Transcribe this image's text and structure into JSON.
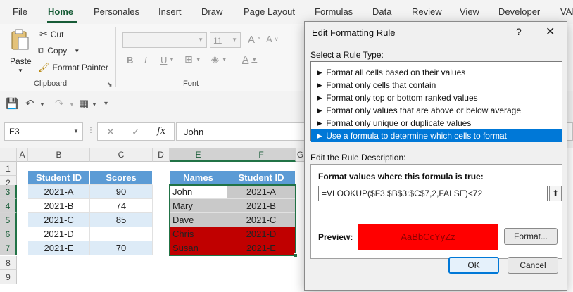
{
  "tabs": [
    "File",
    "Home",
    "Personales",
    "Insert",
    "Draw",
    "Page Layout",
    "Formulas",
    "Data",
    "Review",
    "View",
    "Developer",
    "VAI"
  ],
  "ribbon": {
    "paste_label": "Paste",
    "cut_label": "Cut",
    "copy_label": "Copy",
    "format_painter_label": "Format Painter",
    "clipboard_group": "Clipboard",
    "font_size": "11",
    "font_group": "Font",
    "bold": "B",
    "italic": "I",
    "underline": "U"
  },
  "formula_bar": {
    "name_box": "E3",
    "fx": "fx",
    "value": "John"
  },
  "columns": [
    "A",
    "B",
    "C",
    "D",
    "E",
    "F",
    "G"
  ],
  "rows": [
    "1",
    "2",
    "3",
    "4",
    "5",
    "6",
    "7",
    "8",
    "9"
  ],
  "scores_table": {
    "headers": [
      "Student ID",
      "Scores"
    ],
    "rows": [
      [
        "2021-A",
        "90"
      ],
      [
        "2021-B",
        "74"
      ],
      [
        "2021-C",
        "85"
      ],
      [
        "2021-D",
        ""
      ],
      [
        "2021-E",
        "70"
      ]
    ]
  },
  "names_table": {
    "headers": [
      "Names",
      "Student ID"
    ],
    "rows": [
      [
        "John",
        "2021-A"
      ],
      [
        "Mary",
        "2021-B"
      ],
      [
        "Dave",
        "2021-C"
      ],
      [
        "Chris",
        "2021-D"
      ],
      [
        "Susan",
        "2021-E"
      ]
    ],
    "row_fill": [
      "white",
      "grey",
      "grey",
      "red",
      "red"
    ]
  },
  "dialog": {
    "title": "Edit Formatting Rule",
    "help": "?",
    "close": "✕",
    "select_label": "Select a Rule Type:",
    "rule_types": [
      "► Format all cells based on their values",
      "► Format only cells that contain",
      "► Format only top or bottom ranked values",
      "► Format only values that are above or below average",
      "► Format only unique or duplicate values",
      "► Use a formula to determine which cells to format"
    ],
    "selected_rule_index": 5,
    "edit_label": "Edit the Rule Description:",
    "formula_heading": "Format values where this formula is true:",
    "formula": "=VLOOKUP($F3,$B$3:$C$7,2,FALSE)<72",
    "preview_label": "Preview:",
    "preview_text": "AaBbCcYyZz",
    "format_button": "Format...",
    "ok_button": "OK",
    "cancel_button": "Cancel"
  },
  "colors": {
    "accent_green": "#217346",
    "table_header_blue": "#5b9bd5",
    "band_blue": "#ddebf7",
    "grey_fill": "#c9c9c9",
    "red_fill": "#c00000",
    "preview_red": "#ff0000",
    "selected_rule_blue": "#0078d7"
  }
}
